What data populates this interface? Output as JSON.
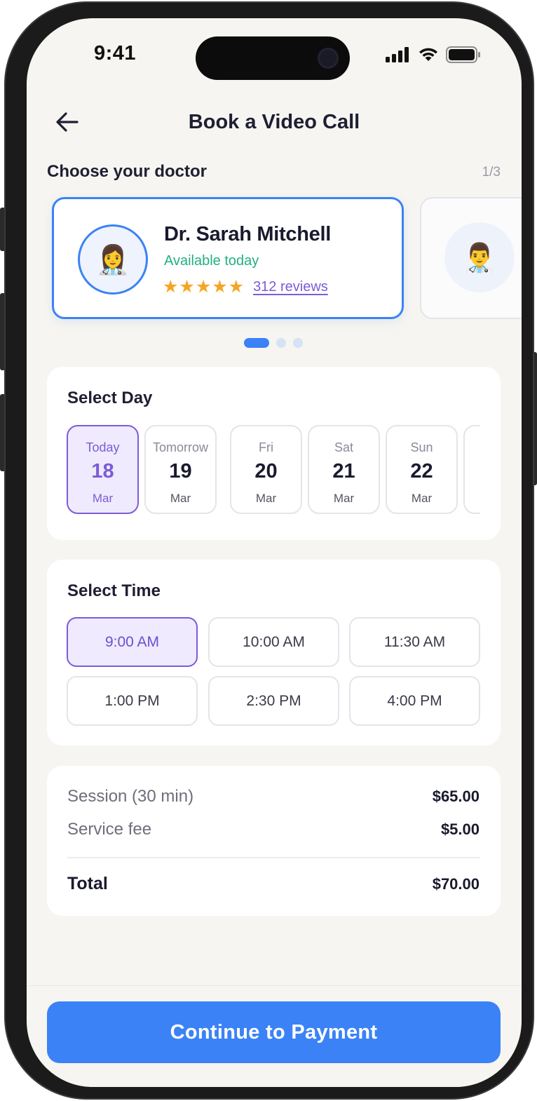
{
  "status_bar": {
    "time": "9:41"
  },
  "header": {
    "title": "Book a Video Call"
  },
  "doctor_section": {
    "label": "Choose your doctor",
    "counter": "1/3",
    "doctors": [
      {
        "name": "Dr. Sarah Mitchell",
        "availability": "Available today",
        "stars": "★★★★★",
        "reviews": "312 reviews",
        "avatar": "👩‍⚕️"
      },
      {
        "avatar": "👨‍⚕️"
      }
    ]
  },
  "day_section": {
    "title": "Select Day",
    "days": [
      {
        "label": "Today",
        "num": "18",
        "month": "Mar"
      },
      {
        "label": "Tomorrow",
        "num": "19",
        "month": "Mar"
      },
      {
        "label": "Fri",
        "num": "20",
        "month": "Mar"
      },
      {
        "label": "Sat",
        "num": "21",
        "month": "Mar"
      },
      {
        "label": "Sun",
        "num": "22",
        "month": "Mar"
      }
    ]
  },
  "time_section": {
    "title": "Select Time",
    "slots": [
      "9:00 AM",
      "10:00 AM",
      "11:30 AM",
      "1:00 PM",
      "2:30 PM",
      "4:00 PM"
    ]
  },
  "pricing": {
    "session_label": "Session (30 min)",
    "session_value": "$65.00",
    "fee_label": "Service fee",
    "fee_value": "$5.00",
    "total_label": "Total",
    "total_value": "$70.00"
  },
  "cta": {
    "label": "Continue to Payment"
  },
  "colors": {
    "accent": "#3b82f6",
    "selection": "#7c5cd6",
    "available": "#22b07d",
    "star": "#f5a524"
  }
}
